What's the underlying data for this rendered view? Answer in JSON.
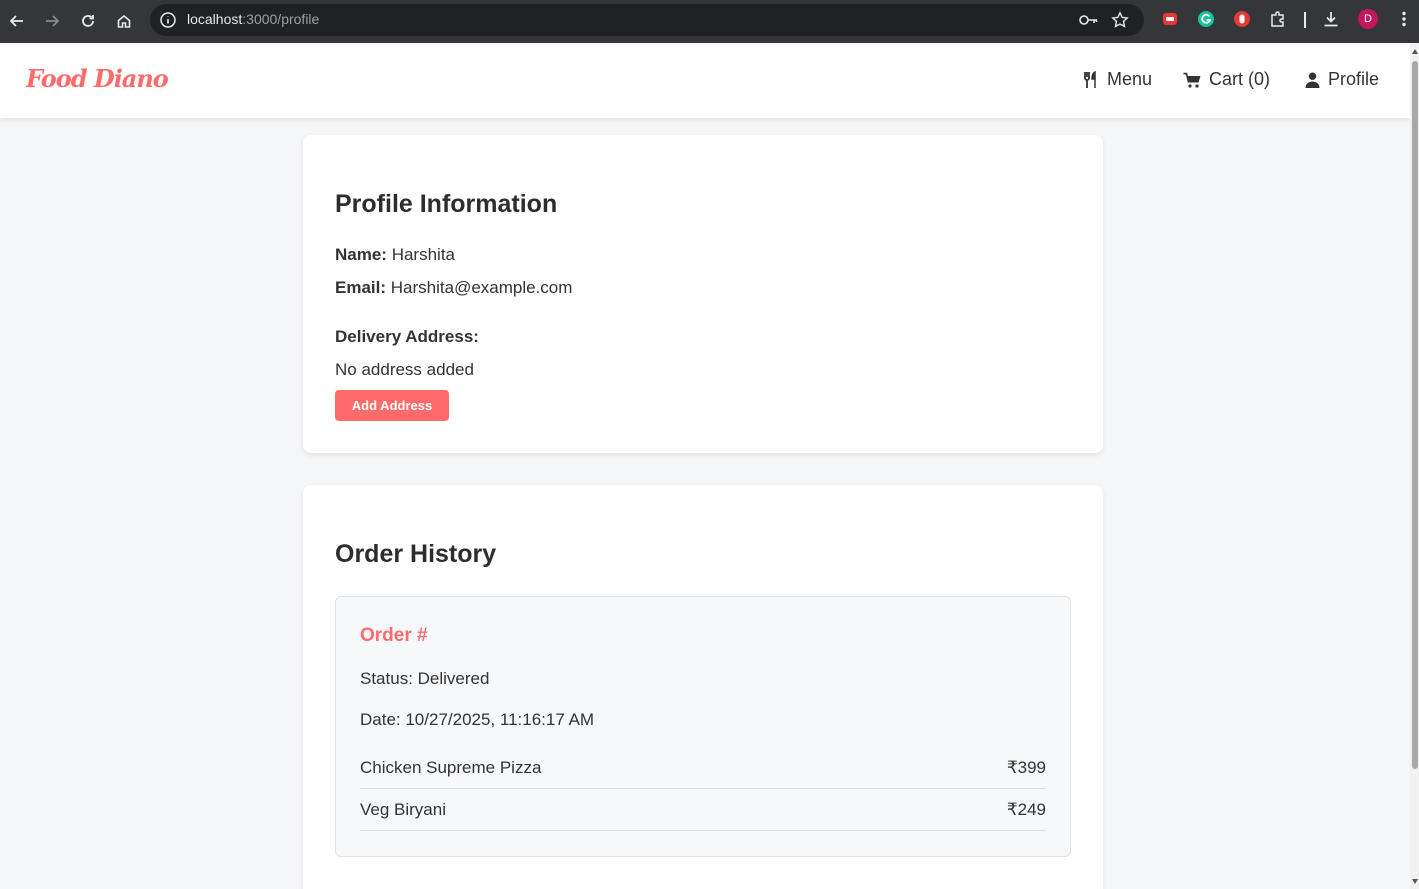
{
  "browser": {
    "url_host": "localhost",
    "url_path": ":3000/profile"
  },
  "profile_avatar_letter": "D",
  "header": {
    "logo": "Food Diano",
    "nav": {
      "menu": "Menu",
      "cart": "Cart (0)",
      "profile": "Profile"
    }
  },
  "profile": {
    "title": "Profile Information",
    "name_label": "Name:",
    "name_value": "Harshita",
    "email_label": "Email:",
    "email_value": "Harshita@example.com",
    "address_label": "Delivery Address:",
    "address_value": "No address added",
    "add_address_button": "Add Address"
  },
  "orders": {
    "title": "Order History",
    "items": [
      {
        "title": "Order #",
        "status": "Status: Delivered",
        "date": "Date: 10/27/2025, 11:16:17 AM",
        "lines": [
          {
            "name": "Chicken Supreme Pizza",
            "price": "₹399"
          },
          {
            "name": "Veg Biryani",
            "price": "₹249"
          }
        ]
      }
    ]
  },
  "colors": {
    "brand": "#ff6b6b",
    "page_bg": "#f5f6f8"
  },
  "icons": {
    "menu": "fork-knife-icon",
    "cart": "shopping-cart-icon",
    "profile": "user-icon"
  }
}
